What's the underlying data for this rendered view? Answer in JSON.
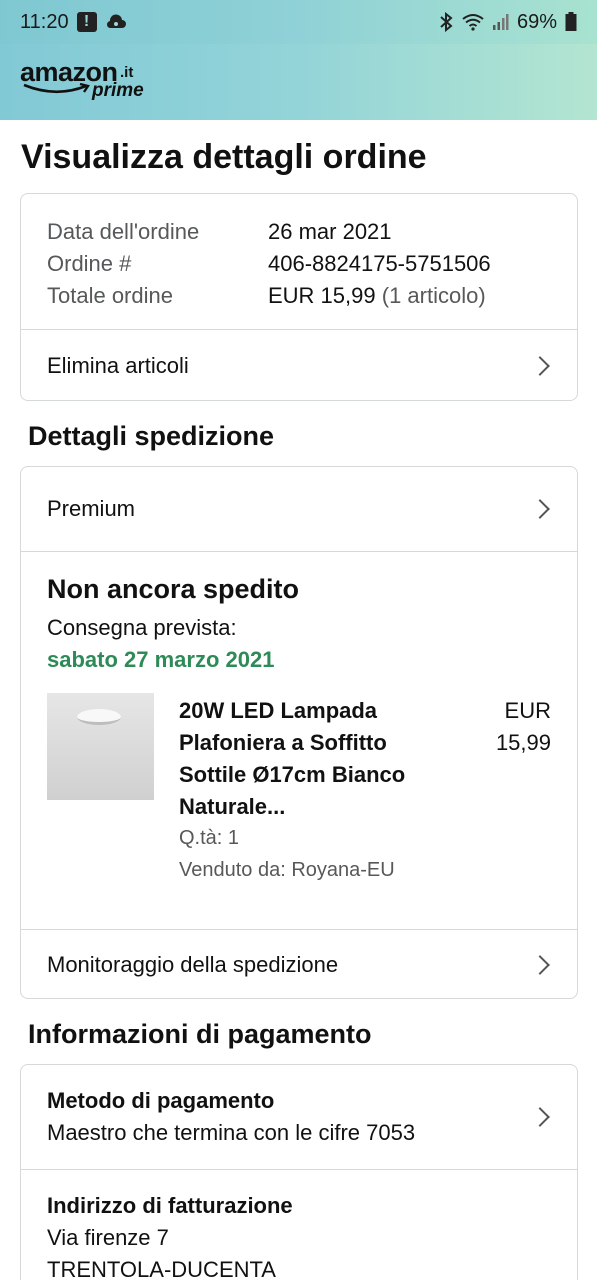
{
  "status_bar": {
    "time": "11:20",
    "battery": "69%",
    "icons": [
      "alert-icon",
      "cloud-icon",
      "bluetooth-icon",
      "wifi-icon",
      "signal-icon",
      "battery-icon"
    ]
  },
  "header": {
    "brand": "amazon",
    "tld": ".it",
    "prime": "prime"
  },
  "page": {
    "title": "Visualizza dettagli ordine"
  },
  "order_summary": {
    "date_label": "Data dell'ordine",
    "date_value": "26 mar 2021",
    "order_label": "Ordine #",
    "order_value": "406-8824175-5751506",
    "total_label": "Totale ordine",
    "total_value": "EUR 15,99",
    "total_items": "(1 articolo)",
    "delete_items": "Elimina articoli"
  },
  "shipping": {
    "section_title": "Dettagli spedizione",
    "method": "Premium",
    "status": "Non ancora spedito",
    "delivery_label": "Consegna prevista:",
    "delivery_date": "sabato 27 marzo 2021",
    "item": {
      "title": "20W LED Lampada Plafoniera a Soffitto Sottile Ø17cm Bianco Naturale...",
      "price_currency": "EUR",
      "price_value": "15,99",
      "quantity": "Q.tà: 1",
      "seller": "Venduto da: Royana-EU"
    },
    "tracking": "Monitoraggio della spedizione"
  },
  "payment": {
    "section_title": "Informazioni di pagamento",
    "method_label": "Metodo di pagamento",
    "method_value": "Maestro che termina con le cifre 7053",
    "billing_label": "Indirizzo di fatturazione",
    "billing_line1": "Via firenze 7",
    "billing_line2": "TRENTOLA-DUCENTA"
  },
  "colors": {
    "header_gradient_start": "#82c9d6",
    "header_gradient_end": "#b3e5d1",
    "delivery_green": "#2e8b57",
    "border": "#d5d9d9"
  }
}
